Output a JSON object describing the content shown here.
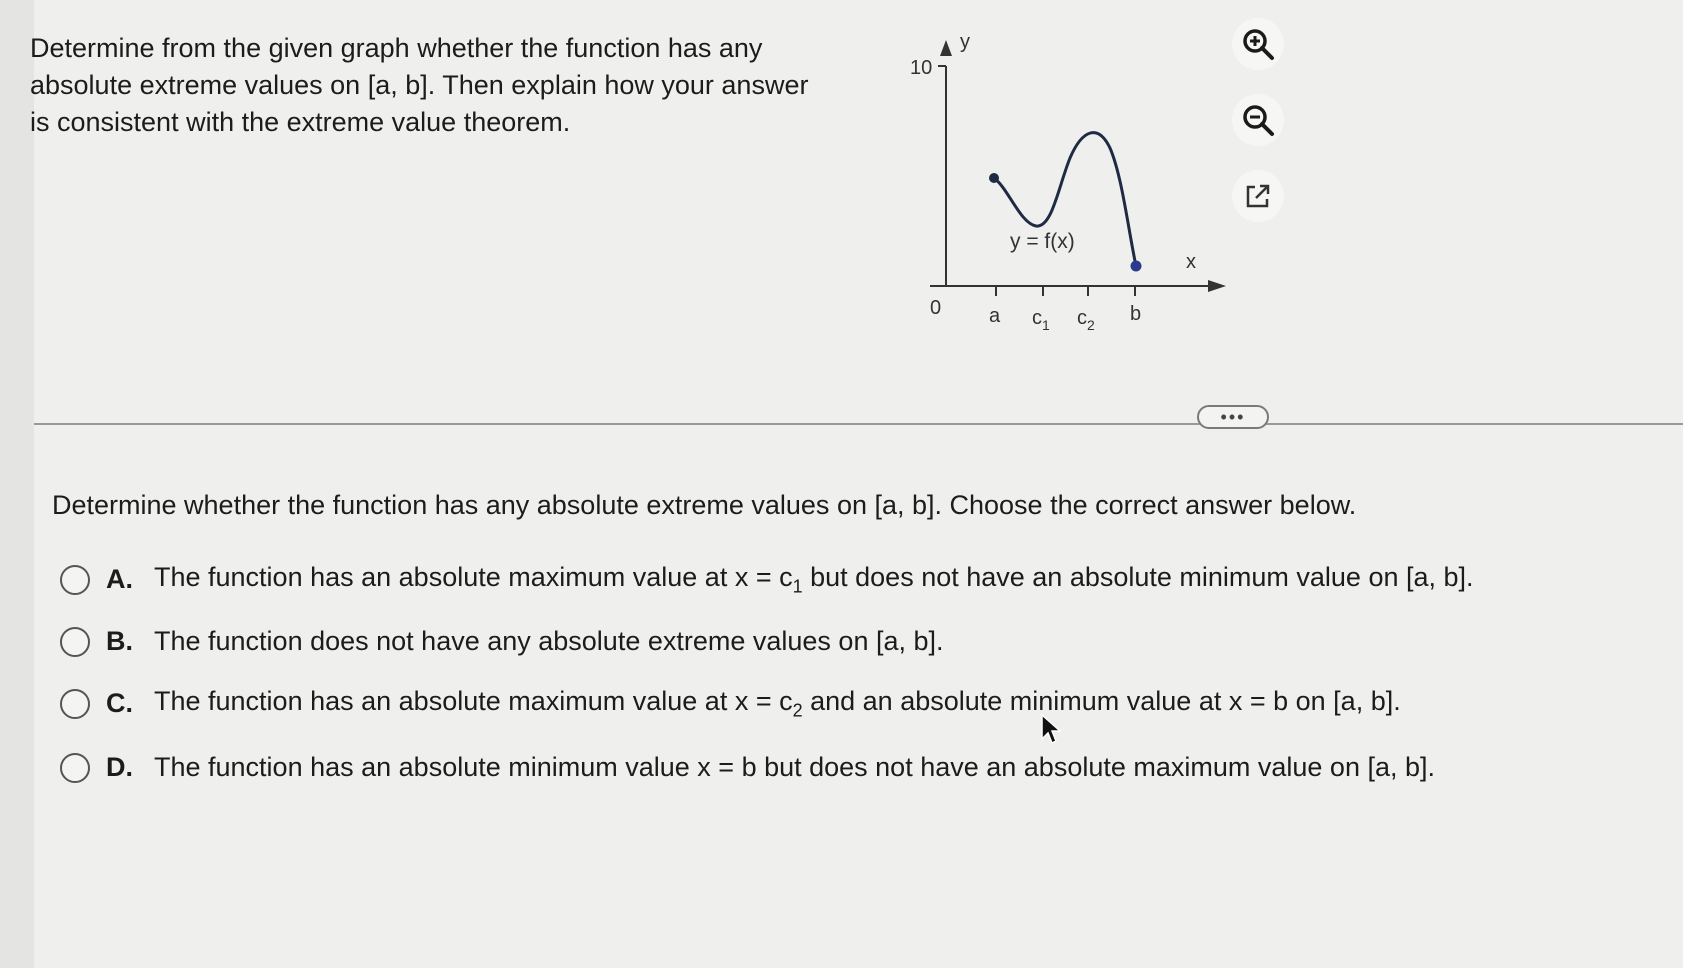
{
  "question": "Determine from the given graph whether the function has any absolute extreme values on [a, b]. Then explain how your answer is consistent with the extreme value theorem.",
  "graph": {
    "y_axis_label": "y",
    "x_axis_label": "x",
    "y_tick": "10",
    "origin": "0",
    "curve_label": "y = f(x)",
    "ticks": {
      "a": "a",
      "c1_base": "c",
      "c1_sub": "1",
      "c2_base": "c",
      "c2_sub": "2",
      "b": "b"
    }
  },
  "tools": {
    "zoom_in": "zoom-in-icon",
    "zoom_out": "zoom-out-icon",
    "popout": "external-link-icon"
  },
  "more_button": "•••",
  "prompt": "Determine whether the function has any absolute extreme values on [a, b]. Choose the correct answer below.",
  "choices": [
    {
      "letter": "A.",
      "pre": "The function has an absolute maximum value at x = c",
      "sub": "1",
      "post": " but does not have an absolute minimum value on [a, b]."
    },
    {
      "letter": "B.",
      "text": "The function does not have any absolute extreme values on [a, b]."
    },
    {
      "letter": "C.",
      "pre": "The function has an absolute maximum value at x = c",
      "sub": "2",
      "post": " and an absolute minimum value at x = b on [a, b]."
    },
    {
      "letter": "D.",
      "text": "The function has an absolute minimum value x = b but does not have an absolute maximum value on [a, b]."
    }
  ],
  "colors": {
    "curve": "#1f2a44",
    "point": "#2a3a8c",
    "accent": "#1a1a1a"
  }
}
